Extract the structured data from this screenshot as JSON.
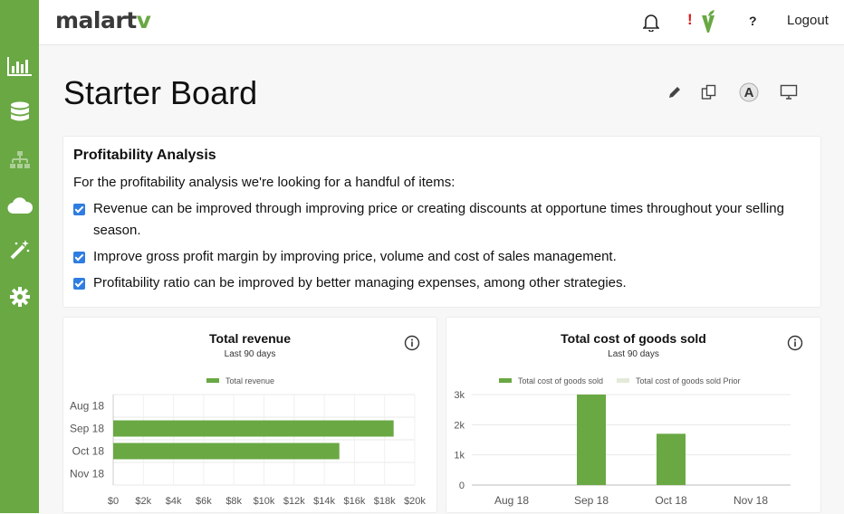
{
  "app": {
    "logo_text": "malart",
    "logo_accent": "v",
    "brand_color": "#69a843"
  },
  "sidebar": {
    "items": [
      {
        "icon": "bar-chart-icon"
      },
      {
        "icon": "database-icon"
      },
      {
        "icon": "sitemap-icon"
      },
      {
        "icon": "cloud-icon"
      },
      {
        "icon": "magic-wand-icon"
      },
      {
        "icon": "gear-icon"
      }
    ]
  },
  "topbar": {
    "help": "?",
    "alert": "!",
    "logout": "Logout"
  },
  "page": {
    "title": "Starter Board"
  },
  "toolbar": [
    "pencil-icon",
    "copy-icon",
    "font-icon",
    "monitor-icon"
  ],
  "analysis": {
    "title": "Profitability Analysis",
    "intro": "For the profitability analysis we're looking for a handful of items:",
    "items": [
      "Revenue can be improved through improving price or creating discounts at opportune times throughout your selling season.",
      "Improve gross profit margin by improving price, volume and cost of sales management.",
      "Profitability ratio can be improved by better managing expenses, among other strategies."
    ]
  },
  "chart_data": [
    {
      "type": "bar",
      "orientation": "horizontal",
      "title": "Total revenue",
      "subtitle": "Last 90 days",
      "categories": [
        "Aug 18",
        "Sep 18",
        "Oct 18",
        "Nov 18"
      ],
      "series": [
        {
          "name": "Total revenue",
          "values": [
            0,
            18600,
            15000,
            0
          ],
          "color": "#69a843"
        }
      ],
      "x_ticks": [
        "$0",
        "$2k",
        "$4k",
        "$6k",
        "$8k",
        "$10k",
        "$12k",
        "$14k",
        "$16k",
        "$18k",
        "$20k"
      ],
      "xlim": [
        0,
        20000
      ],
      "legend": "top",
      "grid": true
    },
    {
      "type": "bar",
      "title": "Total cost of goods sold",
      "subtitle": "Last 90 days",
      "categories": [
        "Aug 18",
        "Sep 18",
        "Oct 18",
        "Nov 18"
      ],
      "series": [
        {
          "name": "Total cost of goods sold",
          "values": [
            0,
            3000,
            1700,
            0
          ],
          "color": "#69a843"
        },
        {
          "name": "Total cost of goods sold Prior",
          "values": [
            0,
            0,
            0,
            0
          ],
          "color": "#e3ead9"
        }
      ],
      "y_ticks": [
        "0",
        "1k",
        "2k",
        "3k"
      ],
      "ylim": [
        0,
        3000
      ],
      "legend": "top",
      "grid": true
    }
  ]
}
